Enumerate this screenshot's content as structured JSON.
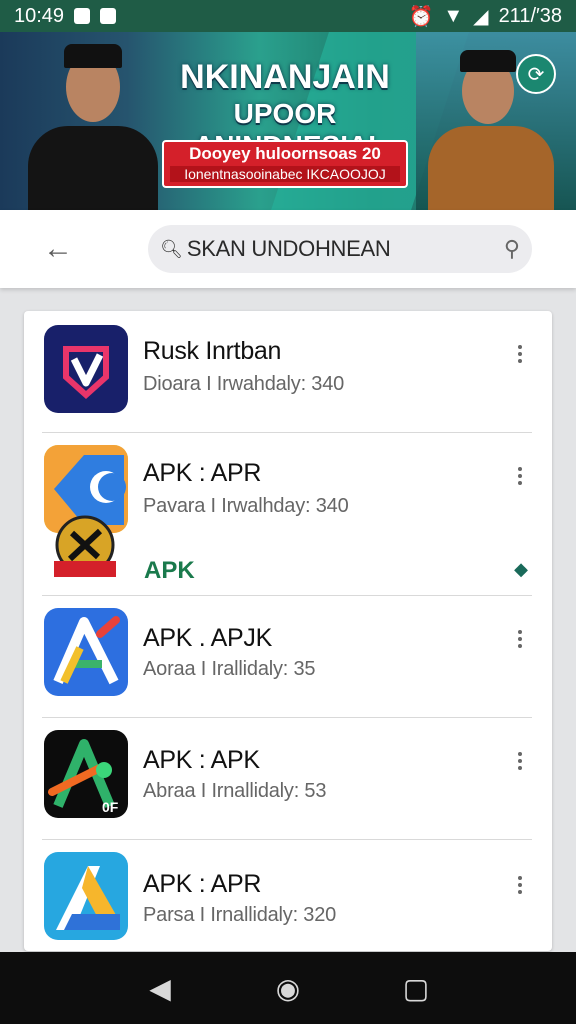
{
  "status_bar": {
    "time": "10:49",
    "right_text": "211/′38"
  },
  "banner": {
    "title_line1": "NKINANJAIN",
    "title_line2": "UPOOR ANINDNESIAI",
    "red_line1": "Dooyey huloornsoas 20",
    "red_line2": "Ionentnasooinabec IKCAOOJOJ"
  },
  "search": {
    "query": "SKAN UNDOHNEAN"
  },
  "apps": [
    {
      "name": "Rusk Inrtban",
      "meta": "Dioara I Irwahdaly: 340"
    },
    {
      "name": "APK : APR",
      "meta": "Pavara I Irwalhday: 340",
      "extra_label": "APK"
    },
    {
      "name": "APK . APJK",
      "meta": "Aoraa I Irallidaly: 35"
    },
    {
      "name": "APK : APK",
      "meta": "Abraa I Irnallidaly: 53"
    },
    {
      "name": "APK : APR",
      "meta": "Parsa I Irnallidaly: 320"
    }
  ],
  "colors": {
    "status_bar": "#1f5c46",
    "accent_green": "#1a7a4c",
    "nav_bar": "#0d0d0d"
  }
}
